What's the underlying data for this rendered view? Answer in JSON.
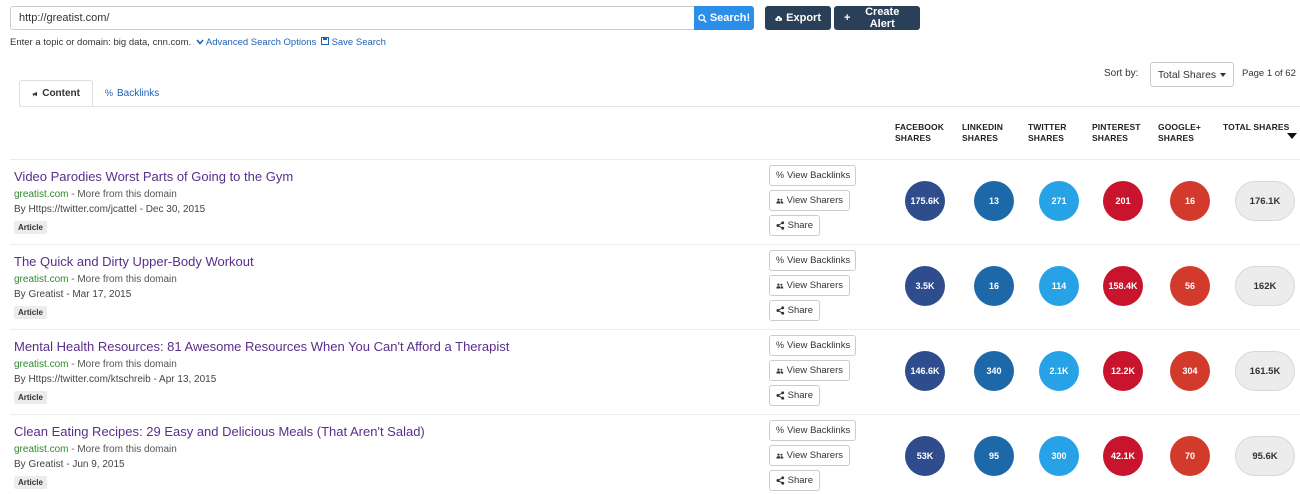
{
  "search": {
    "value": "http://greatist.com/",
    "button_label": "Search!",
    "hint": "Enter a topic or domain: big data, cnn.com.",
    "advanced_label": "Advanced Search Options",
    "save_label": "Save Search"
  },
  "toolbar": {
    "export_label": "Export",
    "create_alert_label": "Create Alert"
  },
  "sort": {
    "label": "Sort by:",
    "selected": "Total Shares",
    "page_info": "Page 1 of 62"
  },
  "tabs": [
    {
      "label": "Content",
      "active": true
    },
    {
      "label": "Backlinks",
      "active": false
    }
  ],
  "columns": {
    "facebook": [
      "FACEBOOK",
      "SHARES"
    ],
    "linkedin": [
      "LINKEDIN",
      "SHARES"
    ],
    "twitter": [
      "TWITTER",
      "SHARES"
    ],
    "pinterest": [
      "PINTEREST",
      "SHARES"
    ],
    "google": [
      "GOOGLE+",
      "SHARES"
    ],
    "total": [
      "TOTAL SHARES",
      ""
    ]
  },
  "actions": {
    "view_backlinks": "View Backlinks",
    "view_sharers": "View Sharers",
    "share": "Share"
  },
  "domain_suffix": " - More from this domain",
  "colors": {
    "facebook": "#2f4c8c",
    "linkedin": "#1c68a8",
    "twitter": "#27a2e6",
    "pinterest": "#c8142c",
    "google": "#d23a2c"
  },
  "rows": [
    {
      "title": "Video Parodies Worst Parts of Going to the Gym",
      "domain": "greatist.com",
      "author": "By Https://twitter.com/jcattel - Dec 30, 2015",
      "badge": "Article",
      "facebook": "175.6K",
      "linkedin": "13",
      "twitter": "271",
      "pinterest": "201",
      "google": "16",
      "total": "176.1K"
    },
    {
      "title": "The Quick and Dirty Upper-Body Workout",
      "domain": "greatist.com",
      "author": "By Greatist - Mar 17, 2015",
      "badge": "Article",
      "facebook": "3.5K",
      "linkedin": "16",
      "twitter": "114",
      "pinterest": "158.4K",
      "google": "56",
      "total": "162K"
    },
    {
      "title": "Mental Health Resources: 81 Awesome Resources When You Can't Afford a Therapist",
      "domain": "greatist.com",
      "author": "By Https://twitter.com/ktschreib - Apr 13, 2015",
      "badge": "Article",
      "facebook": "146.6K",
      "linkedin": "340",
      "twitter": "2.1K",
      "pinterest": "12.2K",
      "google": "304",
      "total": "161.5K"
    },
    {
      "title": "Clean Eating Recipes: 29 Easy and Delicious Meals (That Aren't Salad)",
      "domain": "greatist.com",
      "author": "By Greatist - Jun 9, 2015",
      "badge": "Article",
      "facebook": "53K",
      "linkedin": "95",
      "twitter": "300",
      "pinterest": "42.1K",
      "google": "70",
      "total": "95.6K"
    }
  ]
}
